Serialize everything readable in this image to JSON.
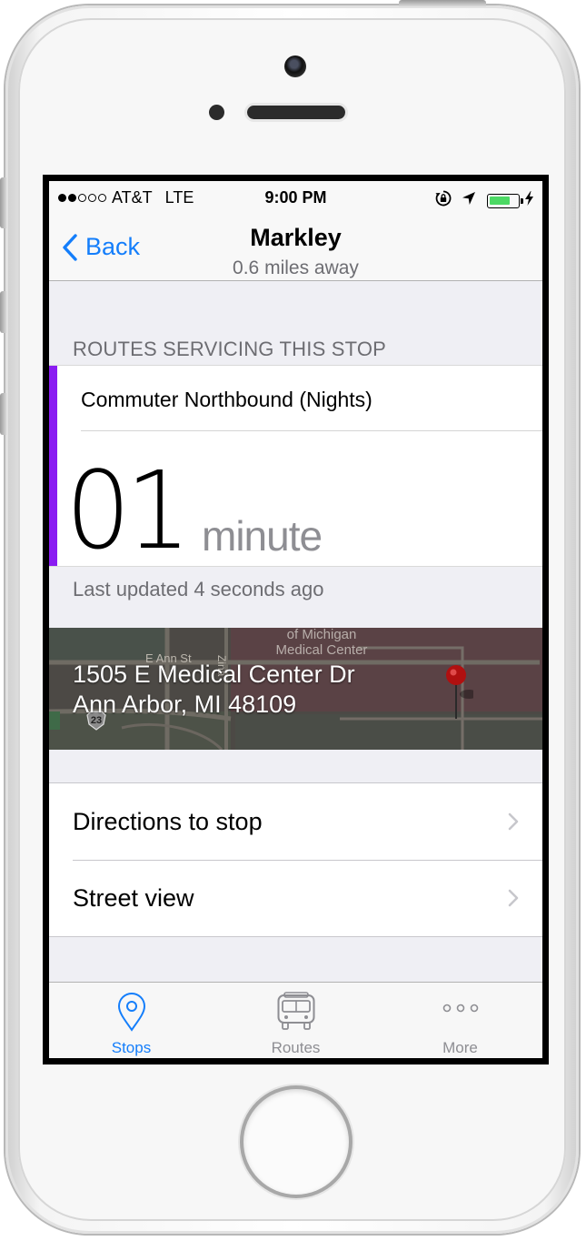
{
  "status_bar": {
    "signal_bars_filled": 2,
    "signal_bars_total": 5,
    "carrier": "AT&T",
    "network": "LTE",
    "time": "9:00 PM",
    "battery_level": 0.75,
    "battery_color": "#4cd964"
  },
  "nav": {
    "back_label": "Back",
    "title": "Markley",
    "subtitle": "0.6 miles away"
  },
  "routes_section": {
    "header": "ROUTES SERVICING THIS STOP",
    "route": {
      "name": "Commuter Northbound (Nights)",
      "color": "#8a1cf2",
      "eta_value": "01",
      "eta_unit": "minute"
    },
    "last_updated": "Last updated 4 seconds ago"
  },
  "location": {
    "address_line1": "1505 E Medical Center Dr",
    "address_line2": "Ann Arbor, MI 48109",
    "map_labels": {
      "street": "E Ann St",
      "street2": "Zina",
      "place_line1": "of Michigan",
      "place_line2": "Medical Center",
      "route_shield": "23"
    }
  },
  "actions": [
    {
      "label": "Directions to stop"
    },
    {
      "label": "Street view"
    }
  ],
  "tab_bar": {
    "tabs": [
      {
        "label": "Stops",
        "icon": "location-pin-icon",
        "selected": true
      },
      {
        "label": "Routes",
        "icon": "bus-icon",
        "selected": false
      },
      {
        "label": "More",
        "icon": "more-dots-icon",
        "selected": false
      }
    ],
    "active_color": "#147efb",
    "inactive_color": "#8e8e93"
  }
}
